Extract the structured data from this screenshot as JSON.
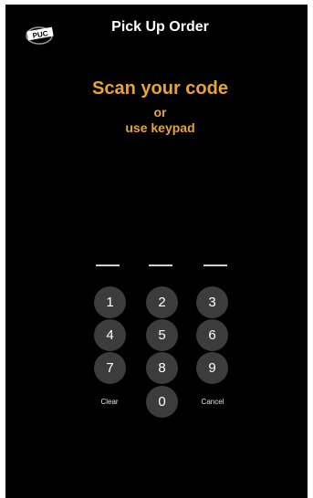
{
  "header": {
    "logo_text": "PUC",
    "title": "Pick Up Order"
  },
  "prompt": {
    "main": "Scan your code",
    "or": "or",
    "keypad": "use keypad"
  },
  "code_slots": [
    "",
    "",
    ""
  ],
  "keypad": {
    "keys": [
      "1",
      "2",
      "3",
      "4",
      "5",
      "6",
      "7",
      "8",
      "9",
      "0"
    ],
    "clear_label": "Clear",
    "cancel_label": "Cancel"
  },
  "colors": {
    "background": "#000000",
    "accent": "#e8a33a",
    "key": "#3c3c3c",
    "text": "#ffffff"
  }
}
